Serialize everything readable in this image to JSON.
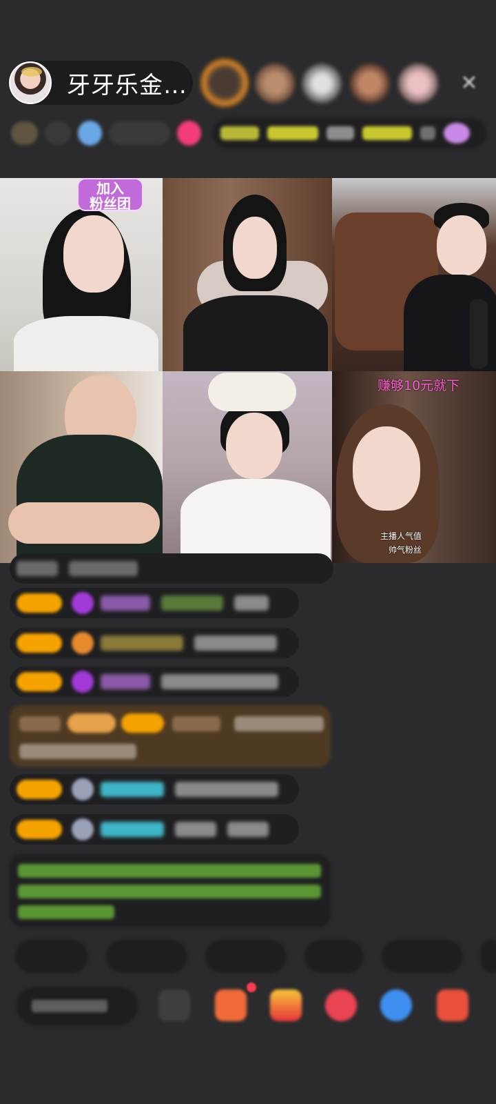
{
  "header": {
    "host_name": "牙牙乐金…",
    "host_avatar_icon": "host-avatar-icon",
    "close_icon": "close-icon",
    "close_glyph": "✕",
    "viewer_count": 5
  },
  "video_grid": {
    "tiles": [
      {
        "name": "guest-1"
      },
      {
        "name": "guest-2"
      },
      {
        "name": "guest-3"
      },
      {
        "name": "guest-4"
      },
      {
        "name": "guest-5"
      },
      {
        "name": "guest-6"
      }
    ],
    "tile1_sticker": "加入\n粉丝团",
    "tile6_banner": "赚够10元就下",
    "tile6_caption_1": "主播人气值",
    "tile6_caption_2": "帅气粉丝"
  },
  "colors": {
    "background": "#2b2b2d",
    "level_badge": "#f5a300",
    "purple_gem": "#a23ad8",
    "cyan_name": "#3fb6c7",
    "green_system": "#6fbd3a",
    "orange_highlight": "#6e4a1e"
  },
  "icons": {
    "gem_icon": "purple-gem-icon",
    "orange_badge_icon": "orange-badge-icon",
    "avatar_icon": "user-avatar-icon",
    "gift_icon": "gift-icon",
    "more_icon": "more-icon",
    "share_icon": "share-icon"
  }
}
